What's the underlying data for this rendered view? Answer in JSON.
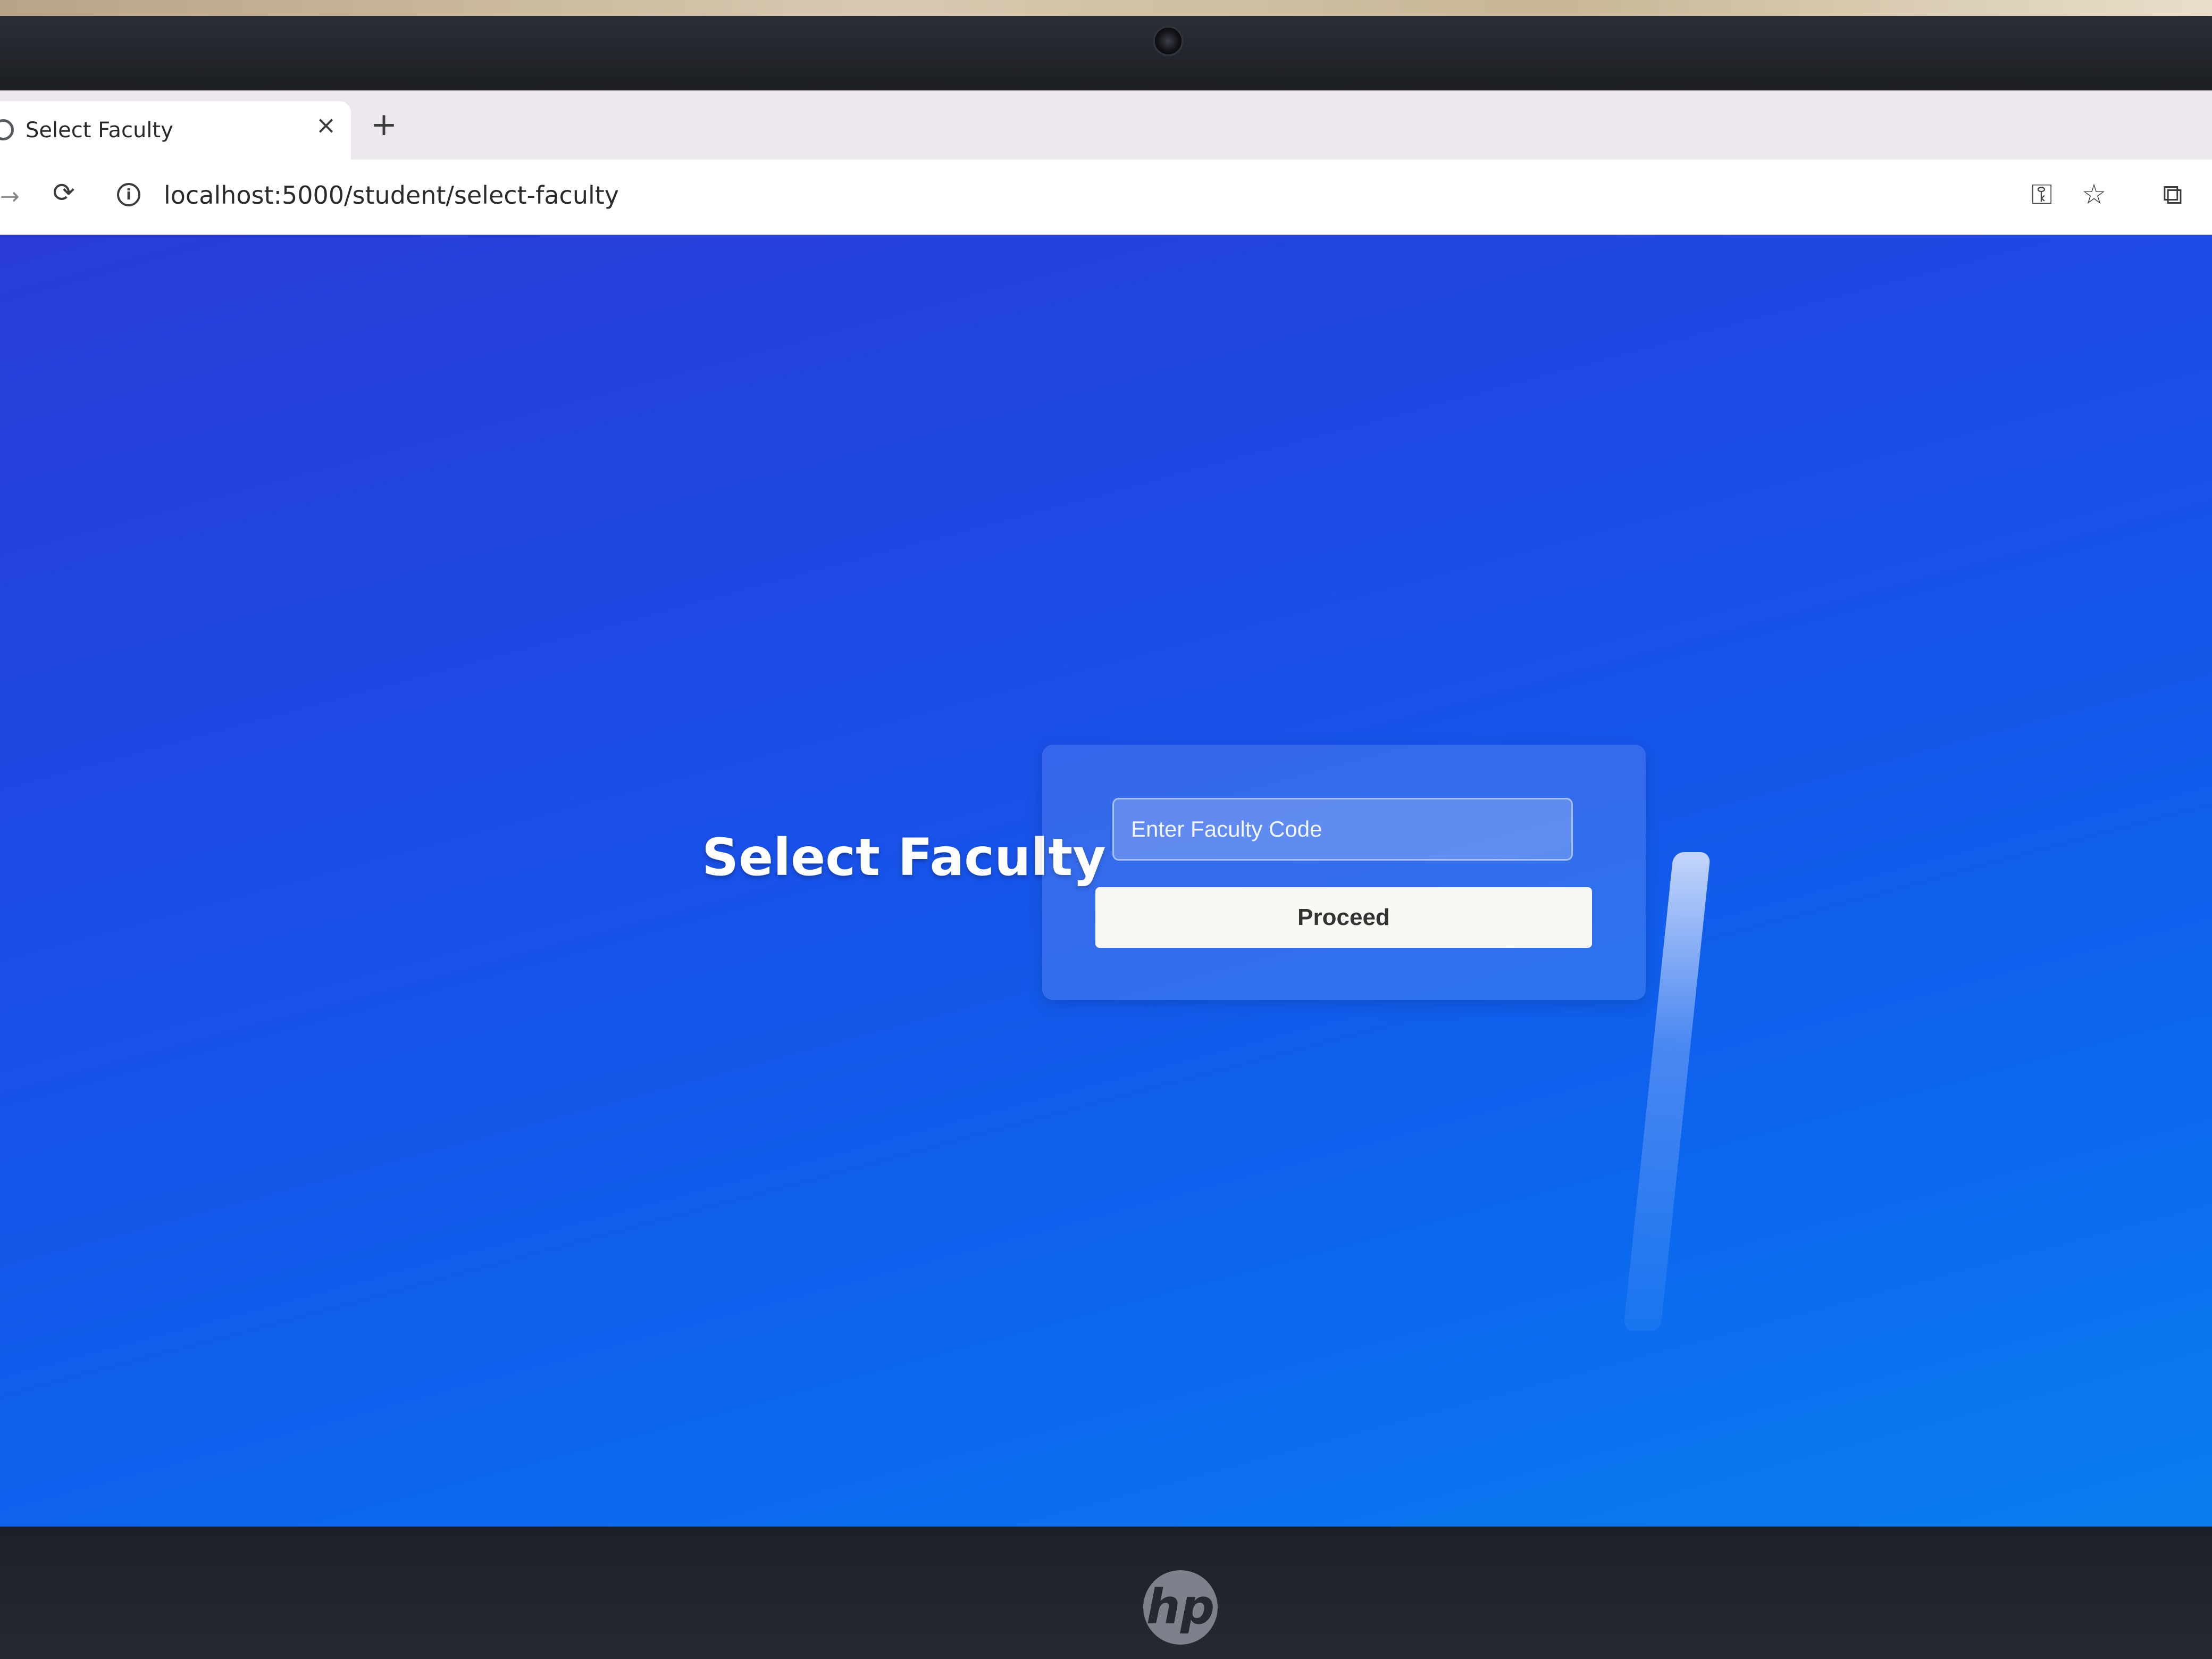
{
  "browser": {
    "tab_title": "Select Faculty",
    "tab_close_icon": "×",
    "new_tab_icon": "+",
    "url": "localhost:5000/student/select-faculty",
    "icons": {
      "back": "→",
      "reload": "⟳",
      "info": "i",
      "password_key": "⚿",
      "bookmark_star": "☆",
      "extensions": "⧉"
    }
  },
  "page": {
    "title": "Select Faculty",
    "faculty_code_placeholder": "Enter Faculty Code",
    "faculty_code_value": "",
    "proceed_label": "Proceed",
    "background_colors": [
      "#2a3cd6",
      "#0a7ef0"
    ]
  },
  "device": {
    "logo": "hp"
  }
}
